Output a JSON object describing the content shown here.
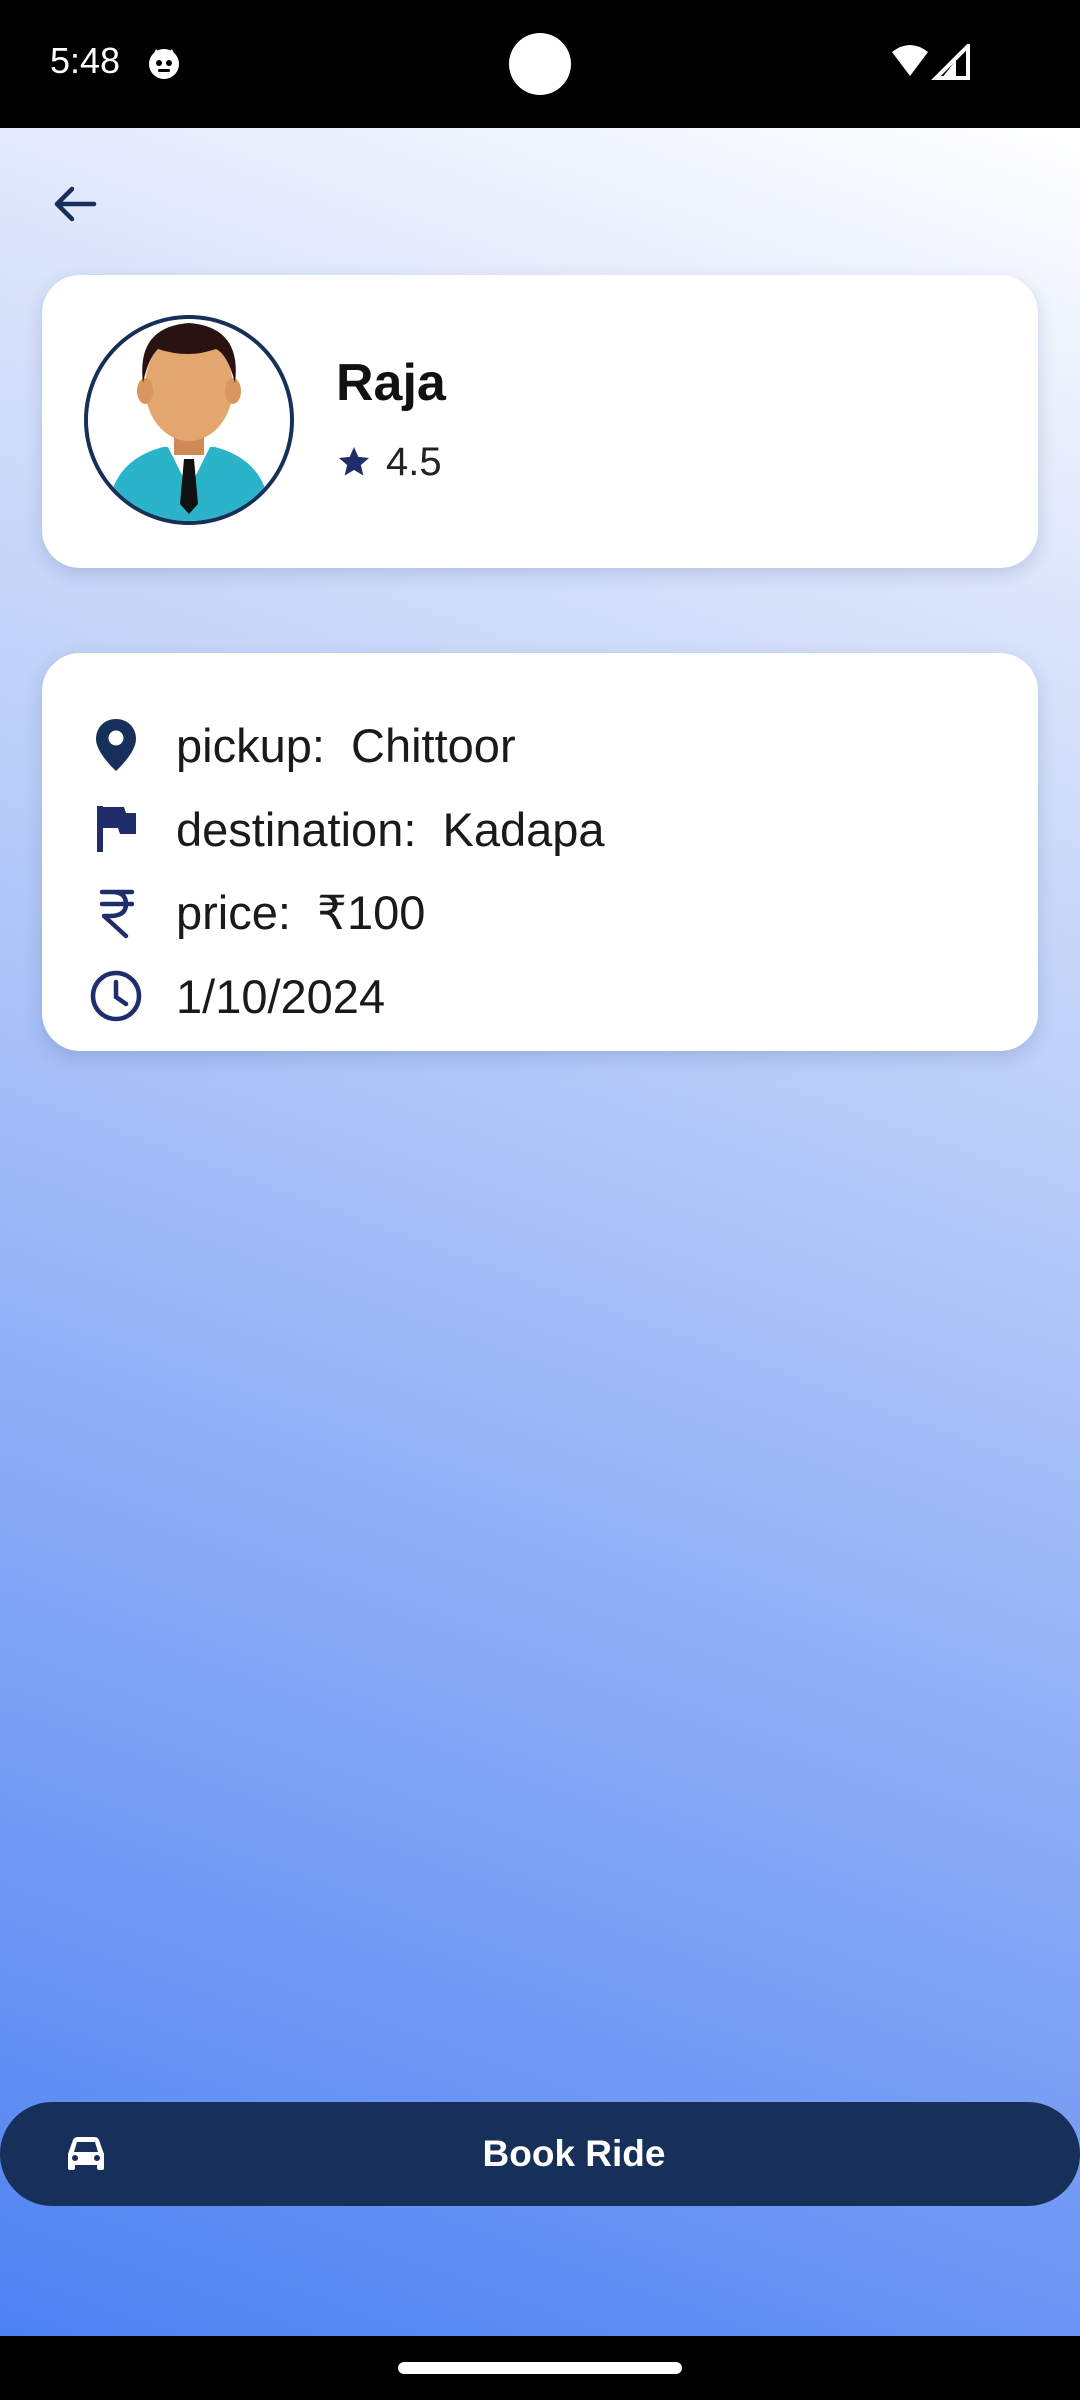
{
  "status_bar": {
    "time": "5:48",
    "app_icon": "cat-face-icon",
    "wifi_icon": "wifi-icon",
    "signal_icon": "cellular-signal-icon"
  },
  "header": {
    "back_icon": "arrow-back-icon"
  },
  "driver": {
    "name": "Raja",
    "rating": "4.5",
    "avatar_icon": "avatar-man-icon",
    "star_icon": "star-icon"
  },
  "ride": {
    "pickup": "pickup:  Chittoor",
    "destination": "destination:  Kadapa",
    "price": "price:  ₹100",
    "date": "1/10/2024",
    "icons": [
      "location-pin-icon",
      "flag-icon",
      "rupee-icon",
      "clock-icon"
    ]
  },
  "actions": {
    "book_label": "Book Ride",
    "car_icon": "car-icon"
  },
  "colors": {
    "accent": "#17305a",
    "icon_navy": "#1f2d6b",
    "background_top": "#ffffff",
    "background_bottom": "#4d82f2"
  }
}
